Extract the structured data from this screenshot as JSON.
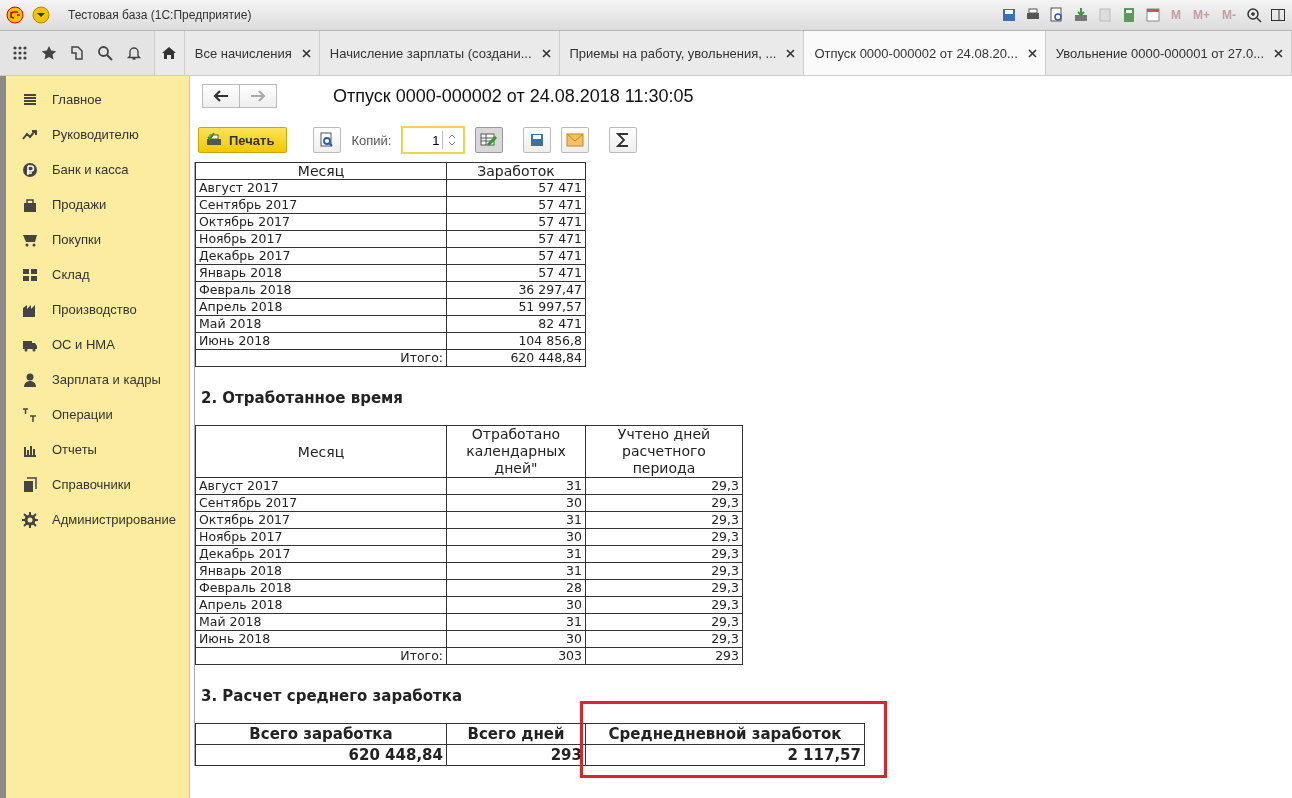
{
  "window": {
    "title": "Тестовая база  (1С:Предприятие)",
    "memory_buttons": [
      {
        "label": "M",
        "disabled": true
      },
      {
        "label": "M+",
        "disabled": true
      },
      {
        "label": "M-",
        "disabled": true
      }
    ]
  },
  "tabs": [
    {
      "label": "Все начисления",
      "selected": false
    },
    {
      "label": "Начисление зарплаты (создани...",
      "selected": false
    },
    {
      "label": "Приемы на работу, увольнения, ...",
      "selected": false
    },
    {
      "label": "Отпуск 0000-000002 от 24.08.20...",
      "selected": true
    },
    {
      "label": "Увольнение 0000-000001 от 27.0...",
      "selected": false
    }
  ],
  "sidebar": {
    "items": [
      "Главное",
      "Руководителю",
      "Банк и касса",
      "Продажи",
      "Покупки",
      "Склад",
      "Производство",
      "ОС и НМА",
      "Зарплата и кадры",
      "Операции",
      "Отчеты",
      "Справочники",
      "Администрирование"
    ]
  },
  "document": {
    "title": "Отпуск 0000-000002 от 24.08.2018 11:30:05",
    "toolbar": {
      "print_button": "Печать",
      "copies_label": "Копий:",
      "copies_value": "1",
      "edit_mode_pressed": true
    },
    "earnings_table": {
      "columns": [
        "Месяц",
        "Заработок"
      ],
      "rows": [
        [
          "Август 2017",
          "57 471"
        ],
        [
          "Сентябрь 2017",
          "57 471"
        ],
        [
          "Октябрь 2017",
          "57 471"
        ],
        [
          "Ноябрь 2017",
          "57 471"
        ],
        [
          "Декабрь 2017",
          "57 471"
        ],
        [
          "Январь 2018",
          "57 471"
        ],
        [
          "Февраль 2018",
          "36 297,47"
        ],
        [
          "Апрель 2018",
          "51 997,57"
        ],
        [
          "Май 2018",
          "82 471"
        ],
        [
          "Июнь 2018",
          "104 856,8"
        ]
      ],
      "total": [
        "Итого:",
        "620 448,84"
      ]
    },
    "section_2": {
      "heading": "2. Отработанное время",
      "columns": [
        "Месяц",
        "Отработано календарных дней\"",
        "Учтено дней расчетного периода"
      ],
      "rows": [
        [
          "Август 2017",
          "31",
          "29,3"
        ],
        [
          "Сентябрь 2017",
          "30",
          "29,3"
        ],
        [
          "Октябрь 2017",
          "31",
          "29,3"
        ],
        [
          "Ноябрь 2017",
          "30",
          "29,3"
        ],
        [
          "Декабрь 2017",
          "31",
          "29,3"
        ],
        [
          "Январь 2018",
          "31",
          "29,3"
        ],
        [
          "Февраль 2018",
          "28",
          "29,3"
        ],
        [
          "Апрель 2018",
          "30",
          "29,3"
        ],
        [
          "Май 2018",
          "31",
          "29,3"
        ],
        [
          "Июнь 2018",
          "30",
          "29,3"
        ]
      ],
      "total": [
        "Итого:",
        "303",
        "293"
      ]
    },
    "section_3": {
      "heading": "3. Расчет среднего  заработка",
      "columns": [
        {
          "label": "Всего заработка",
          "value": "620 448,84",
          "highlighted": false
        },
        {
          "label": "Всего дней",
          "value": "293",
          "highlighted": false
        },
        {
          "label": "Среднедневной заработок",
          "value": "2 117,57",
          "highlighted": true
        }
      ]
    }
  }
}
